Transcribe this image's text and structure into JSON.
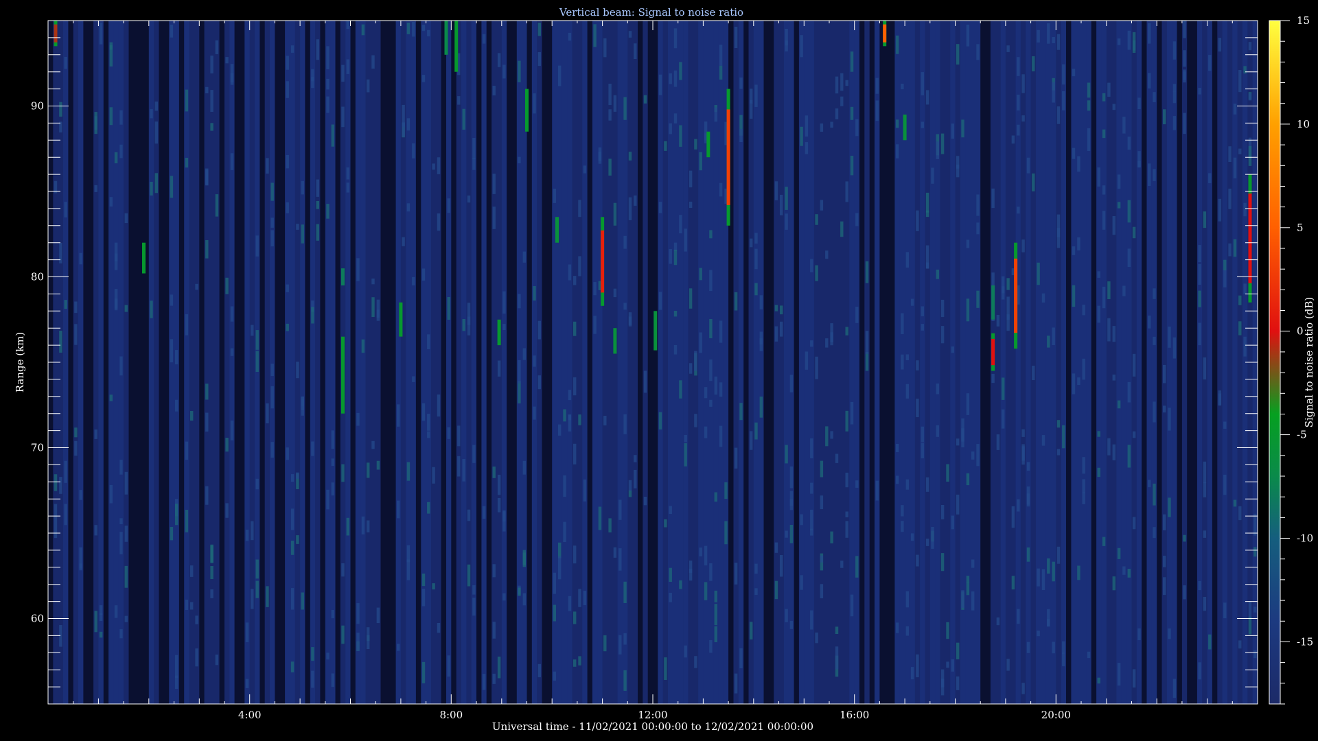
{
  "chart_data": {
    "type": "heatmap",
    "title": "Vertical beam: Signal to noise ratio",
    "xlabel": "Universal time - 11/02/2021 00:00:00 to 12/02/2021 00:00:00",
    "ylabel": "Range (km)",
    "colorbar_label": "Signal to noise ratio (dB)",
    "x_unit": "hours UT",
    "xlim": [
      0,
      24
    ],
    "ylim": [
      55,
      95
    ],
    "color_range": [
      -18,
      15
    ],
    "x_ticks": [
      {
        "value": 4,
        "label": "4:00"
      },
      {
        "value": 8,
        "label": "8:00"
      },
      {
        "value": 12,
        "label": "12:00"
      },
      {
        "value": 16,
        "label": "16:00"
      },
      {
        "value": 20,
        "label": "20:00"
      }
    ],
    "y_ticks": [
      {
        "value": 60,
        "label": "60"
      },
      {
        "value": 70,
        "label": "70"
      },
      {
        "value": 80,
        "label": "80"
      },
      {
        "value": 90,
        "label": "90"
      }
    ],
    "colorbar_ticks": [
      {
        "value": 15,
        "label": "15"
      },
      {
        "value": 10,
        "label": "10"
      },
      {
        "value": 5,
        "label": "5"
      },
      {
        "value": 0,
        "label": "0"
      },
      {
        "value": -5,
        "label": "-5"
      },
      {
        "value": -10,
        "label": "-10"
      },
      {
        "value": -15,
        "label": "-15"
      }
    ],
    "colormap": [
      {
        "value": -18,
        "color": "#1c2a68"
      },
      {
        "value": -14,
        "color": "#1c3a80"
      },
      {
        "value": -10,
        "color": "#155e7e"
      },
      {
        "value": -7,
        "color": "#0a8a4a"
      },
      {
        "value": -4,
        "color": "#06a020"
      },
      {
        "value": 0,
        "color": "#e01010"
      },
      {
        "value": 5,
        "color": "#ff6000"
      },
      {
        "value": 10,
        "color": "#ffa000"
      },
      {
        "value": 15,
        "color": "#ffff40"
      }
    ],
    "background_snr": -17,
    "strong_echoes": [
      {
        "time": 0.15,
        "range_from": 93.5,
        "range_to": 95,
        "snr_peak": -1
      },
      {
        "time": 1.9,
        "range_from": 80.2,
        "range_to": 82,
        "snr_peak": -5
      },
      {
        "time": 5.85,
        "range_from": 72,
        "range_to": 76.5,
        "snr_peak": -5
      },
      {
        "time": 5.85,
        "range_from": 79.5,
        "range_to": 80.5,
        "snr_peak": -8
      },
      {
        "time": 7.0,
        "range_from": 76.5,
        "range_to": 78.5,
        "snr_peak": -5
      },
      {
        "time": 8.1,
        "range_from": 92,
        "range_to": 95,
        "snr_peak": -5
      },
      {
        "time": 7.9,
        "range_from": 93,
        "range_to": 95,
        "snr_peak": -7
      },
      {
        "time": 8.95,
        "range_from": 76,
        "range_to": 77.5,
        "snr_peak": -5
      },
      {
        "time": 9.5,
        "range_from": 88.5,
        "range_to": 91,
        "snr_peak": -5
      },
      {
        "time": 10.1,
        "range_from": 82,
        "range_to": 83.5,
        "snr_peak": -6
      },
      {
        "time": 11.0,
        "range_from": 78.3,
        "range_to": 83.5,
        "snr_peak": 1
      },
      {
        "time": 11.25,
        "range_from": 75.5,
        "range_to": 77,
        "snr_peak": -6
      },
      {
        "time": 12.05,
        "range_from": 75.7,
        "range_to": 78,
        "snr_peak": -6
      },
      {
        "time": 13.1,
        "range_from": 87,
        "range_to": 88.5,
        "snr_peak": -5
      },
      {
        "time": 13.5,
        "range_from": 83,
        "range_to": 91,
        "snr_peak": 3
      },
      {
        "time": 16.6,
        "range_from": 93.5,
        "range_to": 95,
        "snr_peak": 5
      },
      {
        "time": 17.0,
        "range_from": 88,
        "range_to": 89.5,
        "snr_peak": -6
      },
      {
        "time": 18.75,
        "range_from": 74.5,
        "range_to": 76.7,
        "snr_peak": 0
      },
      {
        "time": 18.75,
        "range_from": 77.5,
        "range_to": 79.5,
        "snr_peak": -8
      },
      {
        "time": 19.2,
        "range_from": 75.8,
        "range_to": 82,
        "snr_peak": 3
      },
      {
        "time": 23.85,
        "range_from": 78.5,
        "range_to": 86,
        "snr_peak": 0
      }
    ]
  }
}
